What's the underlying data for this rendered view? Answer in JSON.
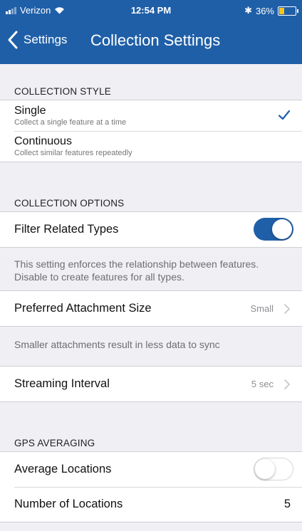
{
  "status_bar": {
    "carrier": "Verizon",
    "time": "12:54 PM",
    "bluetooth": "✱",
    "battery_percent": "36%",
    "battery_level": 0.36,
    "signal_icon": "signal-bars-icon",
    "wifi_icon": "wifi-icon",
    "battery_color": "#f5c518"
  },
  "nav": {
    "back_label": "Settings",
    "title": "Collection Settings",
    "bar_color": "#1f5fa8"
  },
  "collection_style": {
    "header": "COLLECTION STYLE",
    "options": [
      {
        "title": "Single",
        "subtitle": "Collect a single feature at a time",
        "selected": true
      },
      {
        "title": "Continuous",
        "subtitle": "Collect similar features repeatedly",
        "selected": false
      }
    ],
    "check_color": "#1f5fa8"
  },
  "collection_options": {
    "header": "COLLECTION OPTIONS",
    "filter_related_types": {
      "label": "Filter Related Types",
      "enabled": true
    },
    "filter_note": "This setting enforces the relationship between features. Disable to create features for all types.",
    "attachment_size": {
      "label": "Preferred Attachment Size",
      "value": "Small"
    },
    "attachment_note": "Smaller attachments result in less data to sync",
    "streaming_interval": {
      "label": "Streaming Interval",
      "value": "5 sec"
    }
  },
  "gps_averaging": {
    "header": "GPS AVERAGING",
    "average_locations": {
      "label": "Average Locations",
      "enabled": false
    },
    "number_of_locations": {
      "label": "Number of Locations",
      "value": "5"
    }
  }
}
